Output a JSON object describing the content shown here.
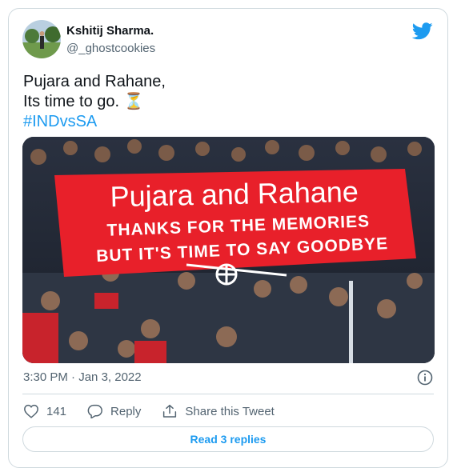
{
  "author": {
    "name": "Kshitij Sharma.",
    "handle": "@_ghostcookies"
  },
  "tweet": {
    "line1": "Pujara and Rahane,",
    "line2": "Its time to go.",
    "emoji": "⏳",
    "hashtag": "#INDvsSA"
  },
  "image": {
    "banner_title": "Pujara and Rahane",
    "banner_line1": "THANKS FOR THE MEMORIES",
    "banner_line2": "BUT IT'S TIME TO SAY GOODBYE"
  },
  "meta": {
    "time": "3:30 PM",
    "separator": " · ",
    "date": "Jan 3, 2022"
  },
  "actions": {
    "likes": "141",
    "reply_label": "Reply",
    "share_label": "Share this Tweet"
  },
  "read_replies": "Read 3 replies",
  "colors": {
    "accent": "#1d9bf0",
    "banner_red": "#e8202a",
    "muted": "#536471"
  },
  "icons": [
    "twitter-bird-icon",
    "info-icon",
    "heart-icon",
    "reply-icon",
    "share-icon"
  ]
}
